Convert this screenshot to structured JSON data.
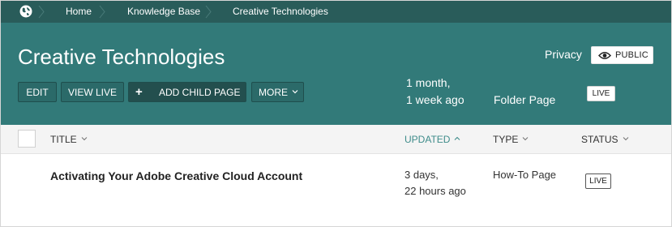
{
  "breadcrumb": {
    "items": [
      "Home",
      "Knowledge Base",
      "Creative Technologies"
    ]
  },
  "header": {
    "title": "Creative Technologies",
    "privacy_label": "Privacy",
    "privacy_value": "PUBLIC",
    "buttons": {
      "edit": "EDIT",
      "view_live": "VIEW LIVE",
      "add_child": "ADD CHILD PAGE",
      "more": "MORE"
    },
    "updated_line1": "1 month,",
    "updated_line2": "1 week ago",
    "type": "Folder Page",
    "status": "LIVE"
  },
  "table": {
    "columns": {
      "title": "TITLE",
      "updated": "UPDATED",
      "type": "TYPE",
      "status": "STATUS"
    },
    "sort": {
      "column": "UPDATED",
      "direction": "ascending"
    },
    "rows": [
      {
        "title": "Activating Your Adobe Creative Cloud Account",
        "updated_line1": "3 days,",
        "updated_line2": "22 hours ago",
        "type": "How-To Page",
        "status": "LIVE"
      }
    ]
  },
  "colors": {
    "breadcrumb_bg": "#295c5a",
    "header_bg": "#327a79",
    "accent": "#3e8c8a"
  },
  "icons": [
    "globe-icon",
    "eye-icon",
    "plus-icon",
    "chevron-down-icon",
    "chevron-up-icon",
    "chevron-right-icon"
  ]
}
